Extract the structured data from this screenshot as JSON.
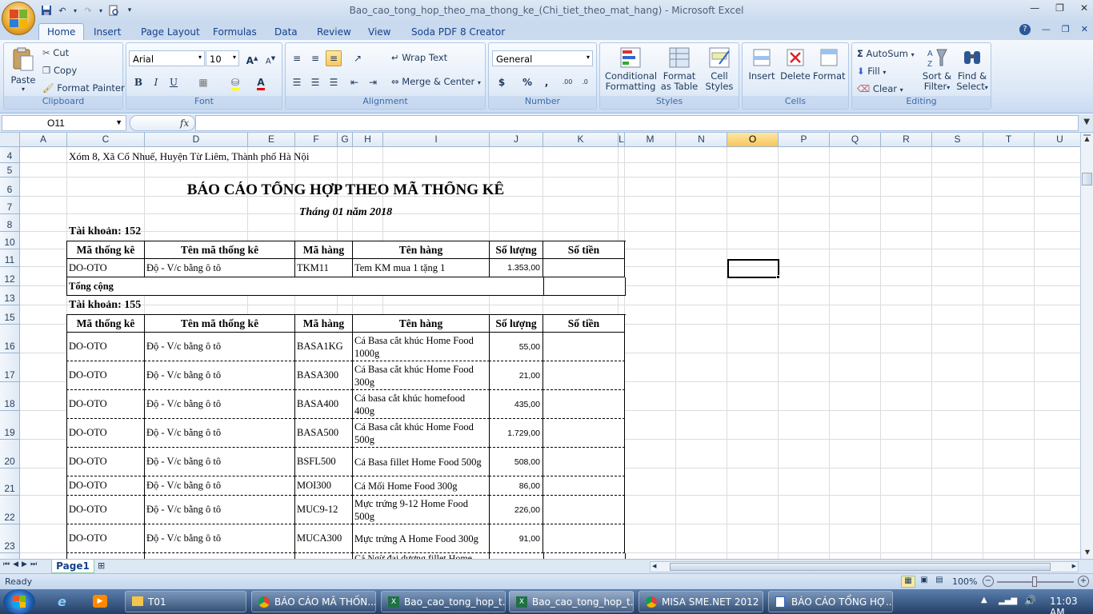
{
  "window": {
    "title": "Bao_cao_tong_hop_theo_ma_thong_ke_(Chi_tiet_theo_mat_hang) - Microsoft Excel"
  },
  "ribbon_tabs": [
    "Home",
    "Insert",
    "Page Layout",
    "Formulas",
    "Data",
    "Review",
    "View",
    "Soda PDF 8 Creator"
  ],
  "clipboard": {
    "paste": "Paste",
    "cut": "Cut",
    "copy": "Copy",
    "format_painter": "Format Painter",
    "label": "Clipboard"
  },
  "font": {
    "name": "Arial",
    "size": "10",
    "label": "Font"
  },
  "alignment": {
    "wrap_text": "Wrap Text",
    "merge_center": "Merge & Center",
    "label": "Alignment"
  },
  "number": {
    "format": "General",
    "currency": "$",
    "percent": "%",
    "comma": ",",
    "label": "Number"
  },
  "styles": {
    "conditional": "Conditional",
    "formatting": "Formatting",
    "format_as": "Format",
    "table": "as Table",
    "cell": "Cell",
    "cell_styles": "Styles",
    "label": "Styles"
  },
  "cells": {
    "insert": "Insert",
    "delete": "Delete",
    "format": "Format",
    "label": "Cells"
  },
  "editing": {
    "autosum": "AutoSum",
    "fill": "Fill",
    "clear": "Clear",
    "sort": "Sort &",
    "filter": "Filter",
    "find": "Find &",
    "select": "Select",
    "label": "Editing"
  },
  "formula_bar": {
    "name_box": "O11",
    "fx": "fx",
    "content": ""
  },
  "columns": [
    "A",
    "C",
    "D",
    "E",
    "F",
    "G",
    "H",
    "I",
    "J",
    "K",
    "L",
    "M",
    "N",
    "O",
    "P",
    "Q",
    "R",
    "S",
    "T",
    "U"
  ],
  "selected_column": "O",
  "rows": [
    "4",
    "5",
    "6",
    "7",
    "8",
    "10",
    "11",
    "12",
    "13",
    "15",
    "16",
    "17",
    "18",
    "19",
    "20",
    "21",
    "22",
    "23"
  ],
  "report": {
    "address": "Xóm 8, Xã Cổ Nhuế, Huyện Từ Liêm, Thành phố Hà Nội",
    "title": "BÁO CÁO TỔNG HỢP THEO MÃ THỐNG KÊ",
    "period": "Tháng 01 năm 2018",
    "account1": "Tài khoản: 152",
    "account2": "Tài khoản: 155",
    "total_label": "Tổng cộng",
    "headers": [
      "Mã thống kê",
      "Tên mã thống kê",
      "Mã hàng",
      "Tên hàng",
      "Số lượng",
      "Số tiền"
    ],
    "table1": [
      {
        "code": "DO-OTO",
        "name": "Độ - V/c bằng ô tô",
        "item": "TKM11",
        "item_name": "Tem KM mua 1 tặng 1",
        "qty": "1.353,00",
        "amount": ""
      }
    ],
    "table2": [
      {
        "code": "DO-OTO",
        "name": "Độ - V/c bằng ô tô",
        "item": "BASA1KG",
        "item_name": "Cá Basa cắt khúc Home Food 1000g",
        "qty": "55,00",
        "amount": ""
      },
      {
        "code": "DO-OTO",
        "name": "Độ - V/c bằng ô tô",
        "item": "BASA300",
        "item_name": "Cá Basa cắt khúc Home Food 300g",
        "qty": "21,00",
        "amount": ""
      },
      {
        "code": "DO-OTO",
        "name": "Độ - V/c bằng ô tô",
        "item": "BASA400",
        "item_name": "Cá basa cắt khúc homefood 400g",
        "qty": "435,00",
        "amount": ""
      },
      {
        "code": "DO-OTO",
        "name": "Độ - V/c bằng ô tô",
        "item": "BASA500",
        "item_name": "Cá Basa cắt khúc Home Food 500g",
        "qty": "1.729,00",
        "amount": ""
      },
      {
        "code": "DO-OTO",
        "name": "Độ - V/c bằng ô tô",
        "item": "BSFL500",
        "item_name": "Cá Basa fillet Home Food 500g",
        "qty": "508,00",
        "amount": ""
      },
      {
        "code": "DO-OTO",
        "name": "Độ - V/c bằng ô tô",
        "item": "MOI300",
        "item_name": "Cá Mối Home Food 300g",
        "qty": "86,00",
        "amount": ""
      },
      {
        "code": "DO-OTO",
        "name": "Độ - V/c bằng ô tô",
        "item": "MUC9-12",
        "item_name": "Mực trứng 9-12 Home Food 500g",
        "qty": "226,00",
        "amount": ""
      },
      {
        "code": "DO-OTO",
        "name": "Độ - V/c bằng ô tô",
        "item": "MUCA300",
        "item_name": "Mực trứng A Home Food 300g",
        "qty": "91,00",
        "amount": ""
      }
    ],
    "partial_row_text": "Cá Ngừ đại dương fillet Home"
  },
  "sheet_tab": "Page1",
  "status": {
    "ready": "Ready",
    "zoom": "100%"
  },
  "taskbar": {
    "items": [
      "T01",
      "BÁO CÁO MÃ THỐN...",
      "Bao_cao_tong_hop_t...",
      "Bao_cao_tong_hop_t...",
      "MISA SME.NET 2012 ...",
      "BÁO CÁO TỔNG HỢ..."
    ],
    "time": "11:03 AM"
  },
  "colors": {
    "accent": "#1e395b",
    "selected_header": "#f8c55a",
    "taskbar": "#233f66"
  }
}
